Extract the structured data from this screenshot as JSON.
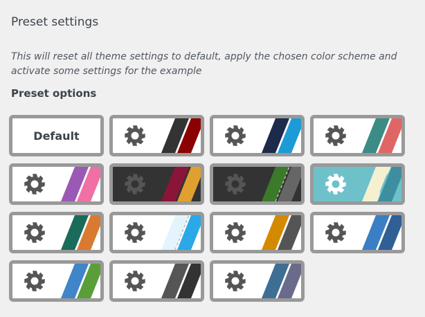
{
  "header": {
    "title": "Preset settings",
    "description": "This will reset all theme settings to default, apply the chosen color scheme and activate some settings for the example",
    "options_title": "Preset options"
  },
  "presets": [
    {
      "label": "Default",
      "icon": "none",
      "bg": "#ffffff",
      "stripes": []
    },
    {
      "icon": "gear-icon",
      "bg": "#ffffff",
      "gear": "#555555",
      "stripes": [
        "#333333",
        "#8b0000"
      ]
    },
    {
      "icon": "gear-icon",
      "bg": "#ffffff",
      "gear": "#555555",
      "stripes": [
        "#1e2a4a",
        "#1d9bd7"
      ]
    },
    {
      "icon": "gear-icon",
      "bg": "#ffffff",
      "gear": "#555555",
      "stripes": [
        "#3d8b85",
        "#e06666"
      ]
    },
    {
      "icon": "gear-icon",
      "bg": "#ffffff",
      "gear": "#555555",
      "stripes": [
        "#9b59b6",
        "#f06fa4"
      ]
    },
    {
      "icon": "gear-icon",
      "bg": "#333333",
      "gear": "#555555",
      "stripes": [
        "#8b1538",
        "#e0a030"
      ]
    },
    {
      "icon": "gear-icon",
      "bg": "#333333",
      "gear": "#555555",
      "stripes": [
        "#3a7a2a",
        "#666666"
      ],
      "dashed": true
    },
    {
      "icon": "gear-icon",
      "bg": "#6fc1c9",
      "gear": "#ffffff",
      "stripes": [
        "#f5f0d0",
        "#3d8fa0"
      ],
      "wavy": true
    },
    {
      "icon": "gear-icon",
      "bg": "#ffffff",
      "gear": "#555555",
      "stripes": [
        "#1a6b5a",
        "#d97a30"
      ]
    },
    {
      "icon": "gear-icon",
      "bg": "#ffffff",
      "gear": "#555555",
      "stripes": [
        "#e3f4fc",
        "#2aa8e8"
      ],
      "dashed": true
    },
    {
      "icon": "gear-icon",
      "bg": "#ffffff",
      "gear": "#555555",
      "stripes": [
        "#d48a00",
        "#555555"
      ]
    },
    {
      "icon": "gear-icon",
      "bg": "#ffffff",
      "gear": "#555555",
      "stripes": [
        "#3a7fc4",
        "#2f5f95"
      ]
    },
    {
      "icon": "gear-icon",
      "bg": "#ffffff",
      "gear": "#555555",
      "stripes": [
        "#3f85c8",
        "#5a9e3a"
      ]
    },
    {
      "icon": "gear-icon",
      "bg": "#ffffff",
      "gear": "#555555",
      "stripes": [
        "#555555",
        "#333333"
      ]
    },
    {
      "icon": "gear-icon",
      "bg": "#ffffff",
      "gear": "#555555",
      "stripes": [
        "#3f6e94",
        "#6a6a8a"
      ]
    }
  ],
  "colors": {
    "tile_border": "#999999",
    "page_bg": "#f0f0f1",
    "text": "#3c434a"
  }
}
